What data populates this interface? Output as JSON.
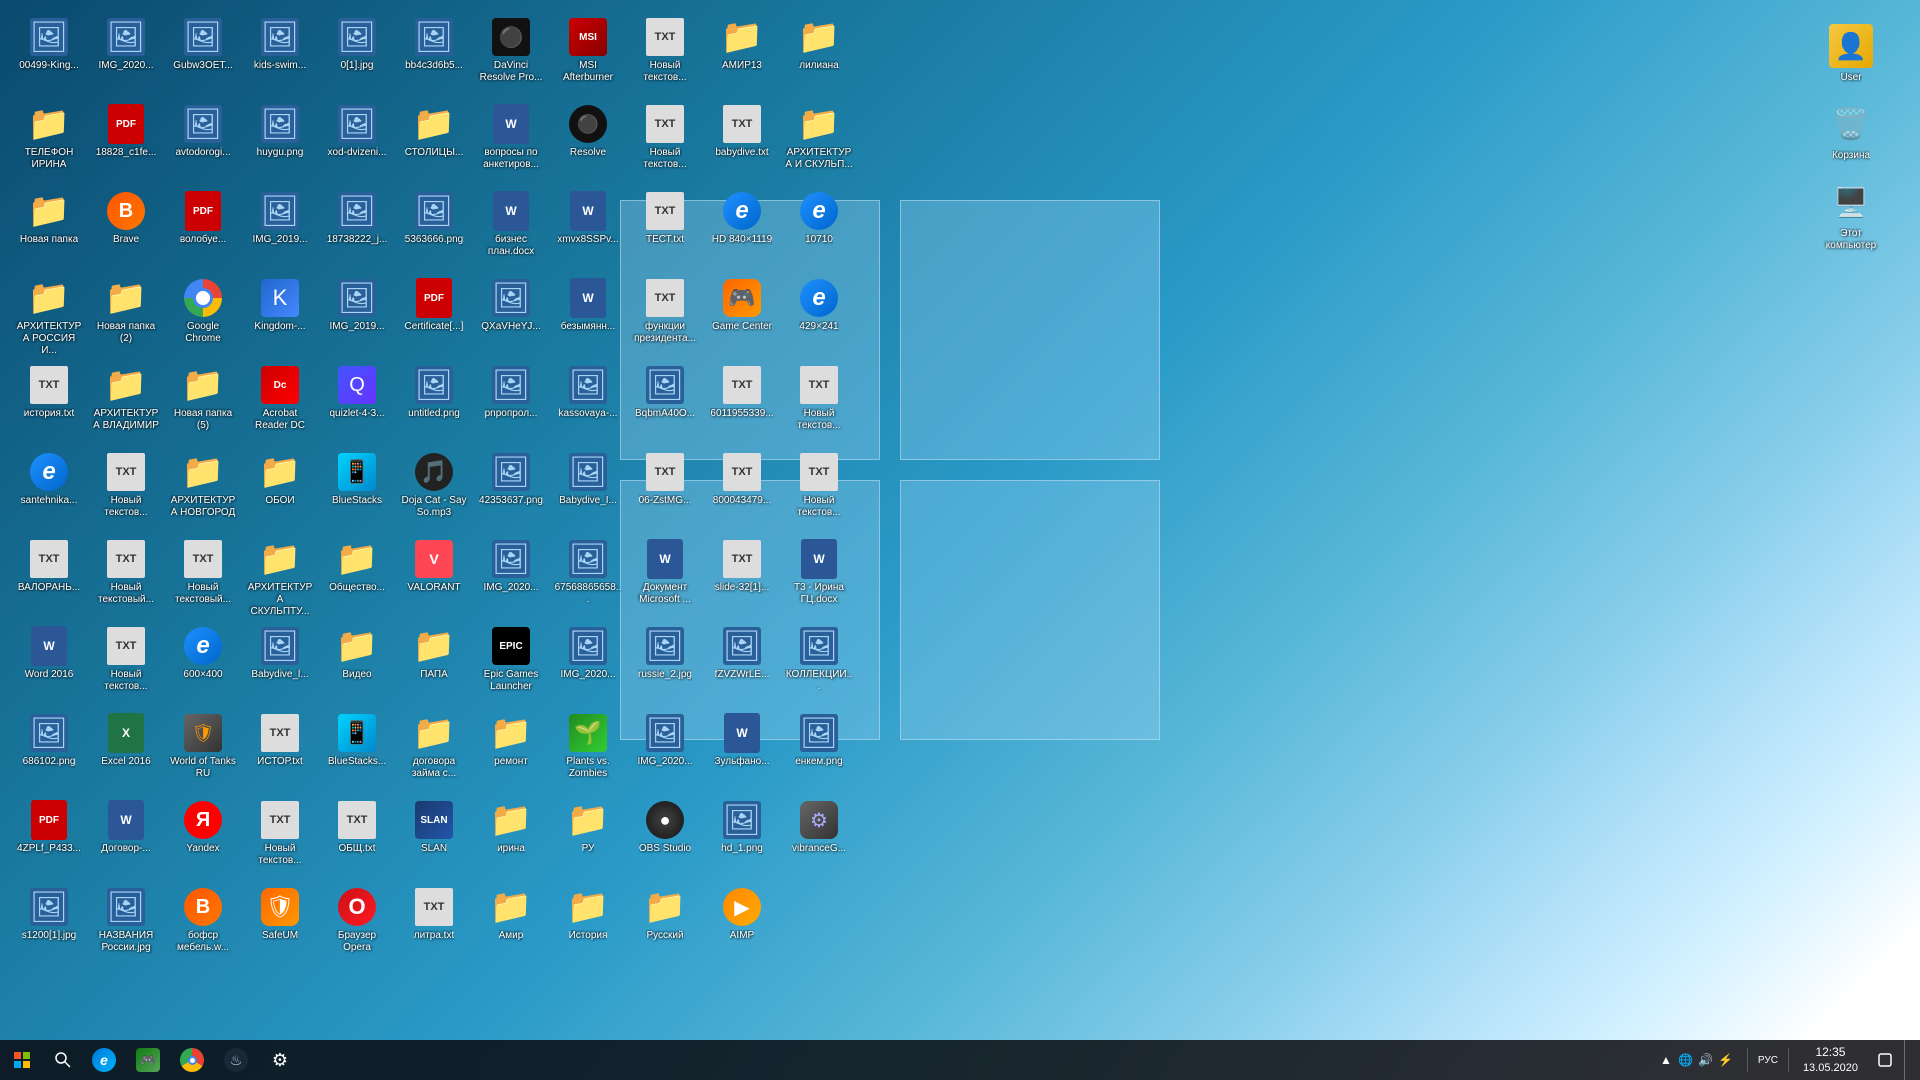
{
  "desktop": {
    "icons": [
      {
        "id": "00499-king",
        "label": "00499-King...",
        "type": "image",
        "emoji": "🖼️"
      },
      {
        "id": "img-2020-1",
        "label": "IMG_2020...",
        "type": "image",
        "emoji": "🖼️"
      },
      {
        "id": "gubw3oet",
        "label": "Gubw3OET...",
        "type": "image",
        "emoji": "🖼️"
      },
      {
        "id": "kids-swim",
        "label": "kids-swim...",
        "type": "image",
        "emoji": "🖼️"
      },
      {
        "id": "0-1-jpg",
        "label": "0[1].jpg",
        "type": "image",
        "emoji": "🖼️"
      },
      {
        "id": "bb4c3d6b5",
        "label": "bb4c3d6b5...",
        "type": "image",
        "emoji": "🖼️"
      },
      {
        "id": "davinci",
        "label": "DaVinci Resolve Pro...",
        "type": "app",
        "special": "davinci"
      },
      {
        "id": "msi",
        "label": "MSI Afterburner",
        "type": "app",
        "special": "msi"
      },
      {
        "id": "new-txt-1",
        "label": "Новый текстов...",
        "type": "txt",
        "emoji": "📄"
      },
      {
        "id": "amir13",
        "label": "АМИР13",
        "type": "folder",
        "emoji": "📁"
      },
      {
        "id": "liliana",
        "label": "лилиана",
        "type": "folder",
        "emoji": "📁"
      },
      {
        "id": "telefon-irina",
        "label": "ТЕЛЕФОН ИРИНА",
        "type": "folder",
        "emoji": "📁"
      },
      {
        "id": "18828-c1fe",
        "label": "18828_c1fe...",
        "type": "pdf",
        "text": "PDF"
      },
      {
        "id": "avtodorog",
        "label": "avtodorogi...",
        "type": "image",
        "emoji": "🖼️"
      },
      {
        "id": "huygu",
        "label": "huygu.png",
        "type": "image",
        "emoji": "🖼️"
      },
      {
        "id": "xod-dvizen",
        "label": "xod-dvizeni...",
        "type": "image",
        "emoji": "🖼️"
      },
      {
        "id": "stolitsy",
        "label": "СТОЛИЦЫ...",
        "type": "folder",
        "emoji": "📁"
      },
      {
        "id": "voprosy-po",
        "label": "вопросы по анкетиров...",
        "type": "word",
        "text": "W"
      },
      {
        "id": "resolve",
        "label": "Resolve",
        "type": "app",
        "special": "resolve"
      },
      {
        "id": "new-txt-2",
        "label": "Новый текстов...",
        "type": "txt",
        "emoji": "📄"
      },
      {
        "id": "babydive",
        "label": "babydive.txt",
        "type": "txt",
        "emoji": "📄"
      },
      {
        "id": "arhitektura-skulp",
        "label": "АРХИТЕКТУРА И СКУЛЬП...",
        "type": "folder",
        "emoji": "📁"
      },
      {
        "id": "novaya-papka-1",
        "label": "Новая папка",
        "type": "folder",
        "emoji": "📁"
      },
      {
        "id": "brave-1",
        "label": "Brave",
        "type": "app",
        "special": "brave"
      },
      {
        "id": "volobuye",
        "label": "волобуе...",
        "type": "pdf",
        "text": "PDF"
      },
      {
        "id": "img-2019-1",
        "label": "IMG_2019...",
        "type": "image",
        "emoji": "🖼️"
      },
      {
        "id": "18738222",
        "label": "18738222_j...",
        "type": "image",
        "emoji": "🖼️"
      },
      {
        "id": "5363666",
        "label": "5363666.png",
        "type": "image",
        "emoji": "🖼️"
      },
      {
        "id": "biznesplan",
        "label": "бизнес план.docx",
        "type": "word",
        "text": "W"
      },
      {
        "id": "xmvx8sspv",
        "label": "xmvx8SSPv...",
        "type": "word",
        "text": "W"
      },
      {
        "id": "test-txt",
        "label": "ТЕСТ.txt",
        "type": "txt",
        "emoji": "📄"
      },
      {
        "id": "hd840",
        "label": "HD 840×1119",
        "type": "app",
        "special": "ie"
      },
      {
        "id": "10710",
        "label": "10710",
        "type": "app",
        "special": "ie"
      },
      {
        "id": "arhitektura-russia",
        "label": "АРХИТЕКТУРА РОССИЯ И...",
        "type": "folder",
        "emoji": "📁"
      },
      {
        "id": "novaya-papka-2",
        "label": "Новая папка (2)",
        "type": "folder",
        "emoji": "📁"
      },
      {
        "id": "google-chrome",
        "label": "Google Chrome",
        "type": "app",
        "special": "chrome"
      },
      {
        "id": "kingdom",
        "label": "Kingdom-...",
        "type": "app",
        "special": "kingdom"
      },
      {
        "id": "img-2019-2",
        "label": "IMG_2019...",
        "type": "image",
        "emoji": "🖼️"
      },
      {
        "id": "certificate",
        "label": "Certificate[...]",
        "type": "pdf",
        "text": "PDF"
      },
      {
        "id": "qxavheyv",
        "label": "QXaVHeYJ...",
        "type": "image",
        "emoji": "🖼️"
      },
      {
        "id": "bezymyann",
        "label": "безымянн...",
        "type": "word",
        "text": "W"
      },
      {
        "id": "funktsii",
        "label": "функции президента...",
        "type": "txt",
        "emoji": "📄"
      },
      {
        "id": "game-center",
        "label": "Game Center",
        "type": "app",
        "special": "gamecenter"
      },
      {
        "id": "429x241",
        "label": "429×241",
        "type": "app",
        "special": "ie"
      },
      {
        "id": "istoriya-txt",
        "label": "история.txt",
        "type": "txt",
        "emoji": "📄"
      },
      {
        "id": "arhitektura-vlad",
        "label": "АРХИТЕКТУРА ВЛАДИМИР",
        "type": "folder",
        "emoji": "📁"
      },
      {
        "id": "novaya-papka-5",
        "label": "Новая папка (5)",
        "type": "folder",
        "emoji": "📁"
      },
      {
        "id": "acrobat",
        "label": "Acrobat Reader DC",
        "type": "app",
        "special": "acrobat"
      },
      {
        "id": "quizlet",
        "label": "quizlet-4-3...",
        "type": "app",
        "special": "quizlet"
      },
      {
        "id": "untitled",
        "label": "untitled.png",
        "type": "image",
        "emoji": "🖼️"
      },
      {
        "id": "pnpoprop",
        "label": "pnpопрол...",
        "type": "image",
        "emoji": "🖼️"
      },
      {
        "id": "kassovaya",
        "label": "kassovaya-...",
        "type": "image",
        "emoji": "🖼️"
      },
      {
        "id": "bqbma400",
        "label": "BqbmA40O...",
        "type": "image",
        "emoji": "🖼️"
      },
      {
        "id": "6011955339",
        "label": "6011955339...",
        "type": "txt",
        "emoji": "📄"
      },
      {
        "id": "new-txt-3",
        "label": "Новый текстов...",
        "type": "txt",
        "emoji": "📄"
      },
      {
        "id": "santehnika",
        "label": "santehnika...",
        "type": "app",
        "special": "ie"
      },
      {
        "id": "new-txt-4",
        "label": "Новый текстов...",
        "type": "txt",
        "emoji": "📄"
      },
      {
        "id": "arhitektura-novg",
        "label": "АРХИТЕКТУРА НОВГОРОД",
        "type": "folder",
        "emoji": "📁"
      },
      {
        "id": "oboi",
        "label": "ОБОИ",
        "type": "folder",
        "emoji": "📁"
      },
      {
        "id": "bluestacks-1",
        "label": "BlueStacks",
        "type": "app",
        "special": "bluestacks"
      },
      {
        "id": "doja",
        "label": "Doja Cat - Say So.mp3",
        "type": "app",
        "special": "doja"
      },
      {
        "id": "42353637",
        "label": "42353637.png",
        "type": "image",
        "emoji": "🖼️"
      },
      {
        "id": "babydive-i",
        "label": "Babydive_I...",
        "type": "image",
        "emoji": "🖼️"
      },
      {
        "id": "06-zstmg",
        "label": "06-ZstMG...",
        "type": "txt",
        "emoji": "📄"
      },
      {
        "id": "800043479",
        "label": "800043479...",
        "type": "txt",
        "emoji": "📄"
      },
      {
        "id": "new-txt-5",
        "label": "Новый текстов...",
        "type": "txt",
        "emoji": "📄"
      },
      {
        "id": "valopanh",
        "label": "ВАЛОРАНЬ...",
        "type": "txt",
        "emoji": "📄"
      },
      {
        "id": "new-txt-6",
        "label": "Новый текстовый...",
        "type": "txt",
        "emoji": "📄"
      },
      {
        "id": "new-txt-7",
        "label": "Новый текстовый...",
        "type": "txt",
        "emoji": "📄"
      },
      {
        "id": "arhitektura-skulp2",
        "label": "АРХИТЕКТУРА СКУЛЬПТУ...",
        "type": "folder",
        "emoji": "📁"
      },
      {
        "id": "obshchestvo",
        "label": "Общество...",
        "type": "folder",
        "emoji": "📁"
      },
      {
        "id": "valorant",
        "label": "VALORANT",
        "type": "app",
        "special": "valorant"
      },
      {
        "id": "img-2020-2",
        "label": "IMG_2020...",
        "type": "image",
        "emoji": "🖼️"
      },
      {
        "id": "67568865658",
        "label": "67568865658...",
        "type": "image",
        "emoji": "🖼️"
      },
      {
        "id": "dokument-ms",
        "label": "Документ Microsoft ...",
        "type": "word",
        "text": "W"
      },
      {
        "id": "slide-32",
        "label": "slide-32[1]...",
        "type": "txt",
        "emoji": "📄"
      },
      {
        "id": "t3-irina",
        "label": "Т3 - Ирина ГЦ.docx",
        "type": "word",
        "text": "W"
      },
      {
        "id": "word-2016",
        "label": "Word 2016",
        "type": "word",
        "text": "W"
      },
      {
        "id": "new-txt-8",
        "label": "Новый текстов...",
        "type": "txt",
        "emoji": "📄"
      },
      {
        "id": "600x400",
        "label": "600×400",
        "type": "app",
        "special": "ie"
      },
      {
        "id": "babydive-l",
        "label": "Babydive_l...",
        "type": "image",
        "emoji": "🖼️"
      },
      {
        "id": "video",
        "label": "Видео",
        "type": "folder",
        "emoji": "📁"
      },
      {
        "id": "papa",
        "label": "ПАПА",
        "type": "folder",
        "emoji": "📁"
      },
      {
        "id": "epicgames",
        "label": "Epic Games Launcher",
        "type": "app",
        "special": "epicgames"
      },
      {
        "id": "img-2020-3",
        "label": "IMG_2020...",
        "type": "image",
        "emoji": "🖼️"
      },
      {
        "id": "russie2",
        "label": "russie_2.jpg",
        "type": "image",
        "emoji": "🖼️"
      },
      {
        "id": "fzvzwrle",
        "label": "fZVZWrLE...",
        "type": "image",
        "emoji": "🖼️"
      },
      {
        "id": "kollekcii",
        "label": "КОЛЛЕКЦИИ...",
        "type": "image",
        "emoji": "🖼️"
      },
      {
        "id": "686102",
        "label": "686102.png",
        "type": "image",
        "emoji": "🖼️"
      },
      {
        "id": "excel-2016",
        "label": "Excel 2016",
        "type": "excel",
        "text": "X"
      },
      {
        "id": "wot",
        "label": "World of Tanks RU",
        "type": "app",
        "special": "wot"
      },
      {
        "id": "istor-txt",
        "label": "ИСТОР.txt",
        "type": "txt",
        "emoji": "📄"
      },
      {
        "id": "bluestacks-2",
        "label": "BlueStacks...",
        "type": "app",
        "special": "bluestacks"
      },
      {
        "id": "dogovor",
        "label": "договора займа с...",
        "type": "folder",
        "emoji": "📁"
      },
      {
        "id": "remont",
        "label": "ремонт",
        "type": "folder",
        "emoji": "📁"
      },
      {
        "id": "plants",
        "label": "Plants vs. Zombies",
        "type": "app",
        "special": "plants"
      },
      {
        "id": "img-2020-4",
        "label": "IMG_2020...",
        "type": "image",
        "emoji": "🖼️"
      },
      {
        "id": "zulfano",
        "label": "Зульфано...",
        "type": "word",
        "text": "W"
      },
      {
        "id": "enkem",
        "label": "енкем.png",
        "type": "image",
        "emoji": "🖼️"
      },
      {
        "id": "4zplf-p433",
        "label": "4ZPLf_P433...",
        "type": "pdf",
        "text": "PDF"
      },
      {
        "id": "dogovor-txt",
        "label": "Договор-...",
        "type": "word",
        "text": "W"
      },
      {
        "id": "yandex",
        "label": "Yandex",
        "type": "app",
        "special": "yandex"
      },
      {
        "id": "new-txt-9",
        "label": "Новый текстов...",
        "type": "txt",
        "emoji": "📄"
      },
      {
        "id": "obshch-txt",
        "label": "ОБЩ.txt",
        "type": "txt",
        "emoji": "📄"
      },
      {
        "id": "slan",
        "label": "SLAN",
        "type": "app",
        "special": "slan"
      },
      {
        "id": "irina-folder",
        "label": "ирина",
        "type": "folder",
        "emoji": "📁"
      },
      {
        "id": "ru-folder",
        "label": "РУ",
        "type": "folder",
        "emoji": "📁"
      },
      {
        "id": "obs",
        "label": "OBS Studio",
        "type": "app",
        "special": "obs"
      },
      {
        "id": "hd1",
        "label": "hd_1.png",
        "type": "image",
        "emoji": "🖼️"
      },
      {
        "id": "vibranceg",
        "label": "vibranceG...",
        "type": "app",
        "special": "vibranceg"
      },
      {
        "id": "s1200-1",
        "label": "s1200[1].jpg",
        "type": "image",
        "emoji": "🖼️"
      },
      {
        "id": "nazvaniya",
        "label": "НАЗВАНИЯ России.jpg",
        "type": "image",
        "emoji": "🖼️"
      },
      {
        "id": "bofsor",
        "label": "бофср мебель.w...",
        "type": "app",
        "special": "brave"
      },
      {
        "id": "safeup",
        "label": "SafeUM",
        "type": "app",
        "special": "safeup"
      },
      {
        "id": "opera",
        "label": "Браузер Opera",
        "type": "app",
        "special": "opera"
      },
      {
        "id": "litra-txt",
        "label": "литра.txt",
        "type": "txt",
        "emoji": "📄"
      },
      {
        "id": "amir-folder",
        "label": "Амир",
        "type": "folder",
        "emoji": "📁"
      },
      {
        "id": "istoriya-folder",
        "label": "История",
        "type": "folder",
        "emoji": "📁"
      },
      {
        "id": "russky",
        "label": "Русский",
        "type": "folder",
        "emoji": "📁"
      },
      {
        "id": "aimp",
        "label": "AIMP",
        "type": "app",
        "special": "aimp"
      }
    ],
    "right_icons": [
      {
        "id": "user",
        "label": "User",
        "type": "user"
      },
      {
        "id": "recycle",
        "label": "Корзина",
        "type": "recycle"
      },
      {
        "id": "computer",
        "label": "Этот компьютер",
        "type": "computer"
      }
    ]
  },
  "taskbar": {
    "start_label": "⊞",
    "search_label": "🔍",
    "apps": [
      {
        "id": "edge",
        "emoji": "e",
        "label": "Microsoft Edge"
      },
      {
        "id": "gamebar",
        "emoji": "🎮",
        "label": "Game Bar"
      },
      {
        "id": "chrome",
        "emoji": "●",
        "label": "Google Chrome"
      },
      {
        "id": "steam",
        "emoji": "♨",
        "label": "Steam"
      }
    ],
    "time": "12:35",
    "date": "13.05.2020",
    "language": "РУС"
  }
}
